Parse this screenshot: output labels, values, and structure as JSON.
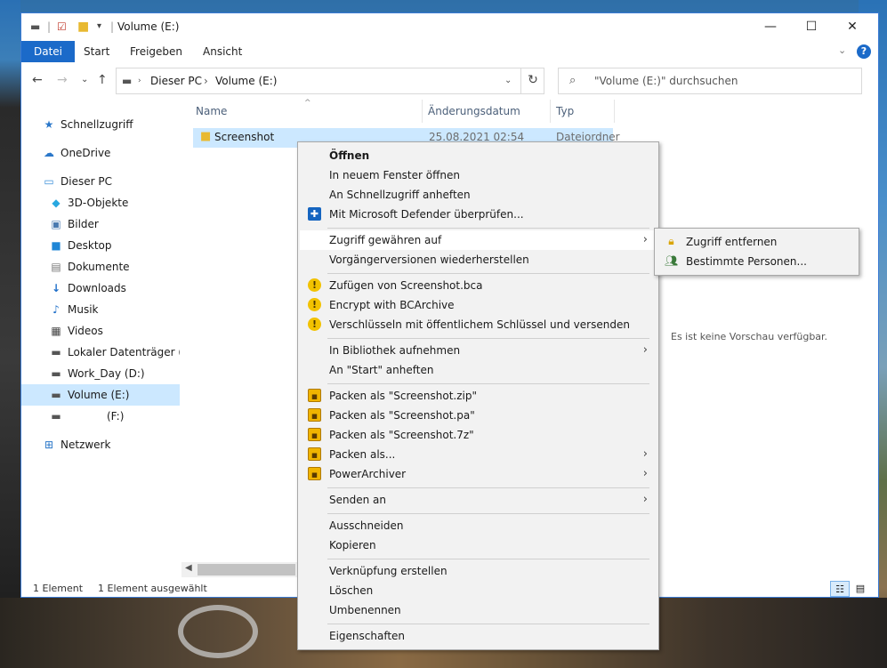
{
  "window": {
    "title": "Volume (E:)",
    "accent": "#1b6ac9"
  },
  "ribbon": {
    "tabs": [
      {
        "label": "Datei"
      },
      {
        "label": "Start"
      },
      {
        "label": "Freigeben"
      },
      {
        "label": "Ansicht"
      }
    ]
  },
  "address": {
    "segments": [
      "Dieser PC",
      "Volume (E:)"
    ]
  },
  "search": {
    "placeholder": "\"Volume (E:)\" durchsuchen"
  },
  "navpane": {
    "items": [
      {
        "label": "Schnellzugriff",
        "icon": "star-icon"
      },
      {
        "label": "OneDrive",
        "icon": "cloud-icon"
      },
      {
        "label": "Dieser PC",
        "icon": "computer-icon"
      },
      {
        "label": "3D-Objekte",
        "icon": "cube-icon"
      },
      {
        "label": "Bilder",
        "icon": "pictures-icon"
      },
      {
        "label": "Desktop",
        "icon": "desktop-icon"
      },
      {
        "label": "Dokumente",
        "icon": "documents-icon"
      },
      {
        "label": "Downloads",
        "icon": "download-icon"
      },
      {
        "label": "Musik",
        "icon": "music-icon"
      },
      {
        "label": "Videos",
        "icon": "video-icon"
      },
      {
        "label": "Lokaler Datenträger (C:)",
        "icon": "drive-icon"
      },
      {
        "label": "Work_Day (D:)",
        "icon": "drive-icon"
      },
      {
        "label": "Volume (E:)",
        "icon": "drive-icon"
      },
      {
        "label": "(F:)",
        "icon": "drive-icon"
      },
      {
        "label": "Netzwerk",
        "icon": "network-icon"
      }
    ]
  },
  "files": {
    "columns": [
      "Name",
      "Änderungsdatum",
      "Typ"
    ],
    "rows": [
      {
        "name": "Screenshot",
        "date": "25.08.2021 02:54",
        "type": "Dateiordner"
      }
    ]
  },
  "preview": {
    "text": "Es ist keine Vorschau verfügbar."
  },
  "status": {
    "count": "1 Element",
    "selected": "1 Element ausgewählt"
  },
  "context_menu": {
    "items": [
      "Öffnen",
      "In neuem Fenster öffnen",
      "An Schnellzugriff anheften",
      "Mit Microsoft Defender überprüfen...",
      "Zugriff gewähren auf",
      "Vorgängerversionen wiederherstellen",
      "Zufügen von Screenshot.bca",
      "Encrypt with BCArchive",
      "Verschlüsseln mit öffentlichem Schlüssel und versenden",
      "In Bibliothek aufnehmen",
      "An \"Start\" anheften",
      "Packen als \"Screenshot.zip\"",
      "Packen als \"Screenshot.pa\"",
      "Packen als \"Screenshot.7z\"",
      "Packen als...",
      "PowerArchiver",
      "Senden an",
      "Ausschneiden",
      "Kopieren",
      "Verknüpfung erstellen",
      "Löschen",
      "Umbenennen",
      "Eigenschaften"
    ]
  },
  "submenu": {
    "items": [
      "Zugriff entfernen",
      "Bestimmte Personen..."
    ]
  }
}
